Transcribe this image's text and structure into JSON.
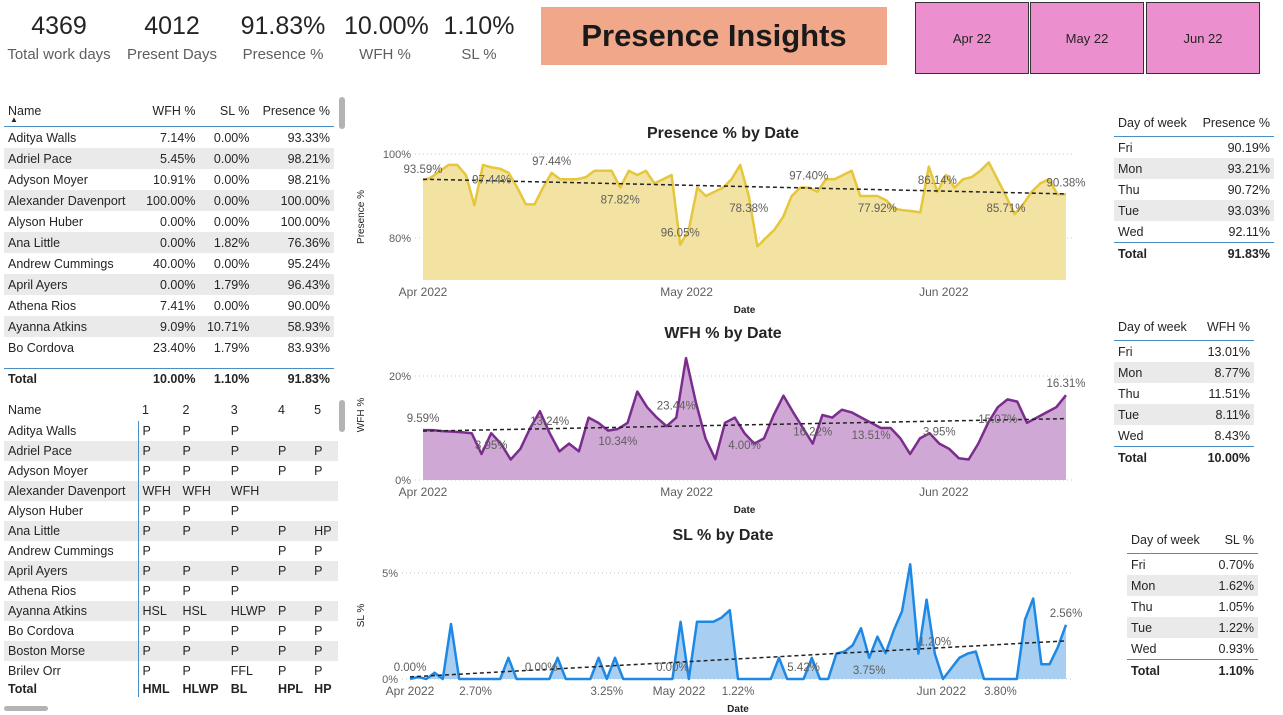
{
  "kpis": [
    {
      "value": "4369",
      "label": "Total work days"
    },
    {
      "value": "4012",
      "label": "Present Days"
    },
    {
      "value": "91.83%",
      "label": "Presence %"
    },
    {
      "value": "10.00%",
      "label": "WFH %"
    },
    {
      "value": "1.10%",
      "label": "SL %"
    }
  ],
  "title": "Presence Insights",
  "slicers": [
    "Apr 22",
    "May 22",
    "Jun 22"
  ],
  "colors": {
    "title_bg": "#f0a78a",
    "slicer_bg": "#ec8fcf",
    "presence": "#e6c63a",
    "presence_fill": "#f2e3a3",
    "wfh": "#7b2d8e",
    "wfh_fill": "#cfa8d6",
    "sl": "#1e88e5",
    "sl_fill": "#a8cff2",
    "table_accent": "#4a90c8"
  },
  "employee_table": {
    "headers": [
      "Name",
      "WFH %",
      "SL %",
      "Presence %"
    ],
    "sort_icon": "sort-ascending-icon",
    "rows": [
      [
        "Aditya Walls",
        "7.14%",
        "0.00%",
        "93.33%"
      ],
      [
        "Adriel Pace",
        "5.45%",
        "0.00%",
        "98.21%"
      ],
      [
        "Adyson Moyer",
        "10.91%",
        "0.00%",
        "98.21%"
      ],
      [
        "Alexander Davenport",
        "100.00%",
        "0.00%",
        "100.00%"
      ],
      [
        "Alyson Huber",
        "0.00%",
        "0.00%",
        "100.00%"
      ],
      [
        "Ana Little",
        "0.00%",
        "1.82%",
        "76.36%"
      ],
      [
        "Andrew Cummings",
        "40.00%",
        "0.00%",
        "95.24%"
      ],
      [
        "April Ayers",
        "0.00%",
        "1.79%",
        "96.43%"
      ],
      [
        "Athena Rios",
        "7.41%",
        "0.00%",
        "90.00%"
      ],
      [
        "Ayanna Atkins",
        "9.09%",
        "10.71%",
        "58.93%"
      ],
      [
        "Bo Cordova",
        "23.40%",
        "1.79%",
        "83.93%"
      ]
    ],
    "total": [
      "Total",
      "10.00%",
      "1.10%",
      "91.83%"
    ]
  },
  "matrix_table": {
    "headers": [
      "Name",
      "1",
      "2",
      "3",
      "4",
      "5"
    ],
    "rows": [
      [
        "Aditya Walls",
        "P",
        "P",
        "P",
        "",
        ""
      ],
      [
        "Adriel Pace",
        "P",
        "P",
        "P",
        "P",
        "P"
      ],
      [
        "Adyson Moyer",
        "P",
        "P",
        "P",
        "P",
        "P"
      ],
      [
        "Alexander Davenport",
        "WFH",
        "WFH",
        "WFH",
        "",
        ""
      ],
      [
        "Alyson Huber",
        "P",
        "P",
        "P",
        "",
        ""
      ],
      [
        "Ana Little",
        "P",
        "P",
        "P",
        "P",
        "HP"
      ],
      [
        "Andrew Cummings",
        "P",
        "",
        "",
        "P",
        "P"
      ],
      [
        "April Ayers",
        "P",
        "P",
        "P",
        "P",
        "P"
      ],
      [
        "Athena Rios",
        "P",
        "P",
        "P",
        "",
        ""
      ],
      [
        "Ayanna Atkins",
        "HSL",
        "HSL",
        "HLWP",
        "P",
        "P"
      ],
      [
        "Bo Cordova",
        "P",
        "P",
        "P",
        "P",
        "P"
      ],
      [
        "Boston Morse",
        "P",
        "P",
        "P",
        "P",
        "P"
      ],
      [
        "Brilev Orr",
        "P",
        "P",
        "FFL",
        "P",
        "P"
      ]
    ],
    "total": [
      "Total",
      "HML",
      "HLWP",
      "BL",
      "HPL",
      "HP"
    ]
  },
  "dow_presence": {
    "headers": [
      "Day of week",
      "Presence %"
    ],
    "rows": [
      [
        "Fri",
        "90.19%"
      ],
      [
        "Mon",
        "93.21%"
      ],
      [
        "Thu",
        "90.72%"
      ],
      [
        "Tue",
        "93.03%"
      ],
      [
        "Wed",
        "92.11%"
      ]
    ],
    "total": [
      "Total",
      "91.83%"
    ]
  },
  "dow_wfh": {
    "headers": [
      "Day of week",
      "WFH %"
    ],
    "rows": [
      [
        "Fri",
        "13.01%"
      ],
      [
        "Mon",
        "8.77%"
      ],
      [
        "Thu",
        "11.51%"
      ],
      [
        "Tue",
        "8.11%"
      ],
      [
        "Wed",
        "8.43%"
      ]
    ],
    "total": [
      "Total",
      "10.00%"
    ]
  },
  "dow_sl": {
    "headers": [
      "Day of week",
      "SL %"
    ],
    "rows": [
      [
        "Fri",
        "0.70%"
      ],
      [
        "Mon",
        "1.62%"
      ],
      [
        "Thu",
        "1.05%"
      ],
      [
        "Tue",
        "1.22%"
      ],
      [
        "Wed",
        "0.93%"
      ]
    ],
    "total": [
      "Total",
      "1.10%"
    ]
  },
  "chart_data": [
    {
      "type": "area",
      "title": "Presence % by Date",
      "xlabel": "Date",
      "ylabel": "Presence %",
      "x_ticks": [
        "Apr 2022",
        "May 2022",
        "Jun 2022"
      ],
      "y_ticks": [
        "80%",
        "100%"
      ],
      "ylim": [
        70,
        100
      ],
      "trendline": [
        94,
        90.5
      ],
      "values": [
        93.6,
        94.5,
        96,
        97.4,
        97.4,
        95,
        87.8,
        97.4,
        96.8,
        96.5,
        95.5,
        92,
        88,
        88,
        92,
        95.5,
        94,
        94,
        94,
        94.5,
        96,
        96,
        96,
        92,
        96,
        95,
        96,
        93,
        94,
        95,
        78.4,
        82,
        92,
        90,
        91,
        92,
        94,
        97.4,
        90,
        78,
        80,
        82,
        85,
        90,
        92,
        92,
        91,
        94,
        94,
        95,
        96,
        90,
        90,
        90,
        89,
        87,
        86.6,
        86.4,
        86.1,
        97,
        91,
        95,
        92,
        94,
        94.5,
        96,
        98,
        94,
        90,
        85.7,
        88,
        91,
        93,
        94,
        90.4,
        90.4
      ],
      "annotations": [
        "93.59%",
        "97.44%",
        "97.44%",
        "87.82%",
        "96.05%",
        "78.38%",
        "97.40%",
        "77.92%",
        "86.14%",
        "85.71%",
        "90.38%"
      ],
      "legend": "none"
    },
    {
      "type": "area",
      "title": "WFH % by Date",
      "xlabel": "Date",
      "ylabel": "WFH %",
      "x_ticks": [
        "Apr 2022",
        "May 2022",
        "Jun 2022"
      ],
      "y_ticks": [
        "0%",
        "20%"
      ],
      "ylim": [
        0,
        25
      ],
      "trendline": [
        9.4,
        11.8
      ],
      "values": [
        9.6,
        9.6,
        9.4,
        9.3,
        9.2,
        9,
        5,
        9,
        7,
        3.95,
        6,
        10,
        13.24,
        9,
        5.5,
        7,
        5.5,
        12,
        11,
        9.5,
        9.8,
        11,
        17,
        14,
        12,
        10.34,
        12,
        23.44,
        15,
        8,
        4,
        11,
        12,
        9,
        7,
        8,
        12.5,
        16.22,
        13,
        10,
        7,
        12.5,
        12,
        13.51,
        13,
        12,
        11,
        10,
        10,
        8,
        5,
        8,
        9,
        7,
        6,
        4.2,
        3.95,
        7,
        11,
        14,
        15.5,
        15.07,
        11,
        12,
        13,
        14,
        16.31
      ],
      "annotations": [
        "9.59%",
        "3.95%",
        "13.24%",
        "10.34%",
        "23.44%",
        "4.00%",
        "16.22%",
        "13.51%",
        "3.95%",
        "15.07%",
        "16.31%"
      ],
      "legend": "none"
    },
    {
      "type": "area",
      "title": "SL % by Date",
      "xlabel": "Date",
      "ylabel": "SL %",
      "x_ticks": [
        "Apr 2022",
        "May 2022",
        "Jun 2022"
      ],
      "y_ticks": [
        "0%",
        "5%"
      ],
      "ylim": [
        0,
        6
      ],
      "trendline": [
        0.1,
        1.8
      ],
      "values": [
        0,
        0.1,
        0,
        0.3,
        0,
        2.6,
        0,
        0,
        0,
        0,
        0,
        0,
        1,
        0,
        0,
        0,
        0,
        0,
        1,
        0,
        0,
        0,
        0,
        1,
        0,
        1,
        0,
        0,
        0,
        0,
        0,
        0,
        0,
        2.7,
        0,
        2.7,
        2.7,
        2.7,
        2.9,
        3.25,
        0,
        0,
        0,
        0,
        0,
        1,
        0,
        0,
        0,
        1,
        0,
        0,
        1.2,
        1.3,
        1.6,
        2.4,
        1,
        2,
        1.22,
        2.3,
        3.2,
        5.42,
        1.2,
        3.75,
        1.2,
        0,
        0.5,
        1,
        1.2,
        1.3,
        0,
        0,
        0,
        0,
        0,
        2.8,
        3.8,
        0.7,
        0.7,
        1.5,
        2.56
      ],
      "annotations": [
        "0.00%",
        "2.70%",
        "0.00%",
        "3.25%",
        "0.00%",
        "1.22%",
        "5.42%",
        "3.75%",
        "1.20%",
        "3.80%",
        "2.56%"
      ],
      "legend": "none"
    }
  ]
}
